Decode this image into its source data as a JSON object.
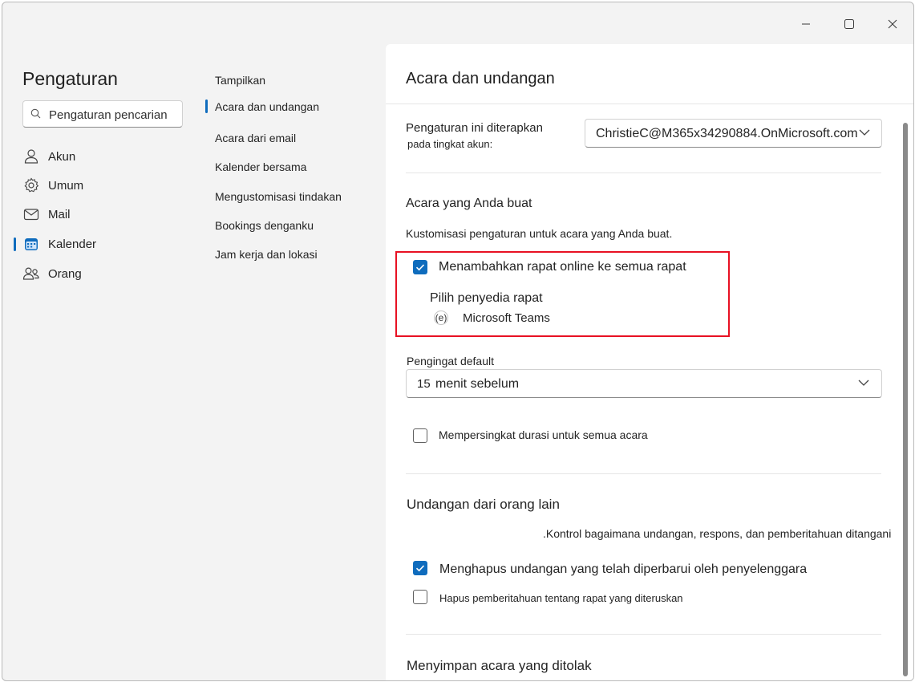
{
  "window": {
    "controls": {
      "minimize": "–",
      "maximize": "☐",
      "close": "✕"
    }
  },
  "nav": {
    "title": "Pengaturan",
    "search_placeholder": "Pengaturan pencarian",
    "items": [
      {
        "label": "Akun",
        "icon": "person-icon"
      },
      {
        "label": "Umum",
        "icon": "gear-icon"
      },
      {
        "label": "Mail",
        "icon": "mail-icon"
      },
      {
        "label": "Kalender",
        "icon": "calendar-icon",
        "active": true
      },
      {
        "label": "Orang",
        "icon": "people-icon"
      }
    ]
  },
  "subnav": {
    "items": [
      {
        "label": "Tampilkan"
      },
      {
        "label": "Acara dan undangan",
        "active": true
      },
      {
        "label": "Acara dari email"
      },
      {
        "label": "Kalender bersama"
      },
      {
        "label": "Mengustomisasi tindakan"
      },
      {
        "label": "Bookings denganku"
      },
      {
        "label": "Jam kerja dan lokasi"
      }
    ]
  },
  "main": {
    "title": "Acara dan undangan",
    "apply_label_line1": "Pengaturan ini diterapkan",
    "apply_label_line2": "pada tingkat akun:",
    "account_value": "ChristieC@M365x34290884.OnMicrosoft.com",
    "section1_title": "Acara yang Anda buat",
    "section1_desc": "Kustomisasi pengaturan untuk acara yang Anda buat.",
    "add_online_meeting": {
      "label": "Menambahkan rapat online ke semua rapat",
      "checked": true
    },
    "provider_label": "Pilih penyedia rapat",
    "provider_radio_glyph": "(e)",
    "provider_value": "Microsoft Teams",
    "reminder_label": "Pengingat default",
    "reminder_number": "15",
    "reminder_unit": "menit sebelum",
    "shorten_duration": {
      "label": "Mempersingkat durasi untuk semua acara",
      "checked": false
    },
    "section2_title": "Undangan dari orang lain",
    "section2_desc": ".Kontrol bagaimana undangan, respons, dan pemberitahuan ditangani",
    "delete_updated_invites": {
      "label": "Menghapus undangan yang telah diperbarui oleh penyelenggara",
      "checked": true
    },
    "delete_forward_notifications": {
      "label": "Hapus pemberitahuan tentang rapat yang diteruskan",
      "checked": false
    },
    "section3_title": "Menyimpan acara yang ditolak"
  },
  "colors": {
    "accent": "#0f6cbd",
    "highlight_border": "#e81123"
  }
}
